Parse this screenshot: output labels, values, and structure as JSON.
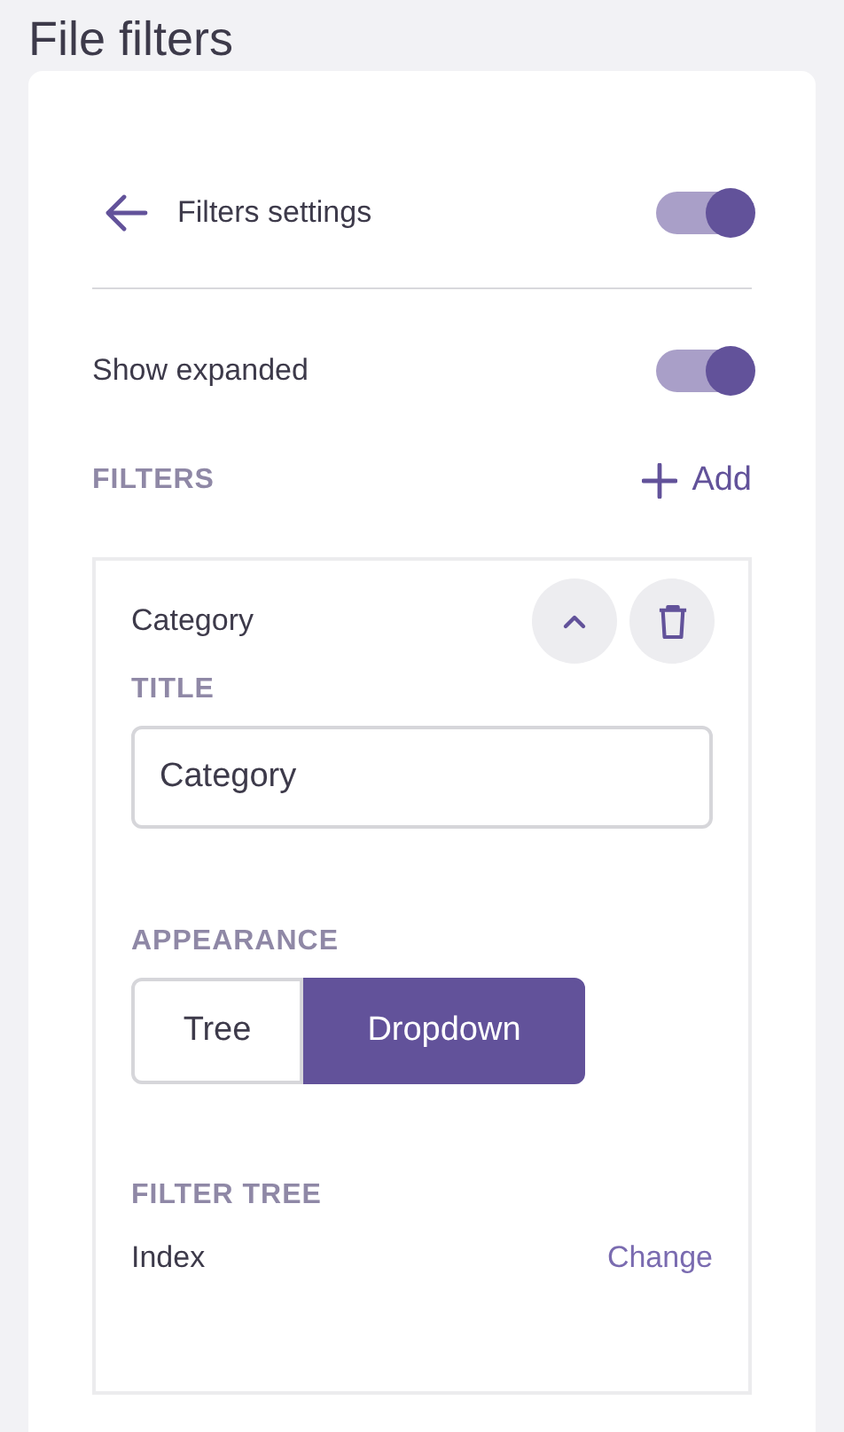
{
  "page_title": "File filters",
  "header": {
    "back_label": "Filters settings",
    "toggle_on": true
  },
  "show_expanded": {
    "label": "Show expanded",
    "on": true
  },
  "filters_section": {
    "label": "FILTERS",
    "add_label": "Add"
  },
  "filters": [
    {
      "name": "Category",
      "expanded": true,
      "title_label": "TITLE",
      "title_value": "Category",
      "appearance_label": "APPEARANCE",
      "appearance_options": [
        {
          "label": "Tree",
          "selected": false
        },
        {
          "label": "Dropdown",
          "selected": true
        }
      ],
      "tree_label": "FILTER TREE",
      "tree_value": "Index",
      "change_label": "Change"
    }
  ]
}
